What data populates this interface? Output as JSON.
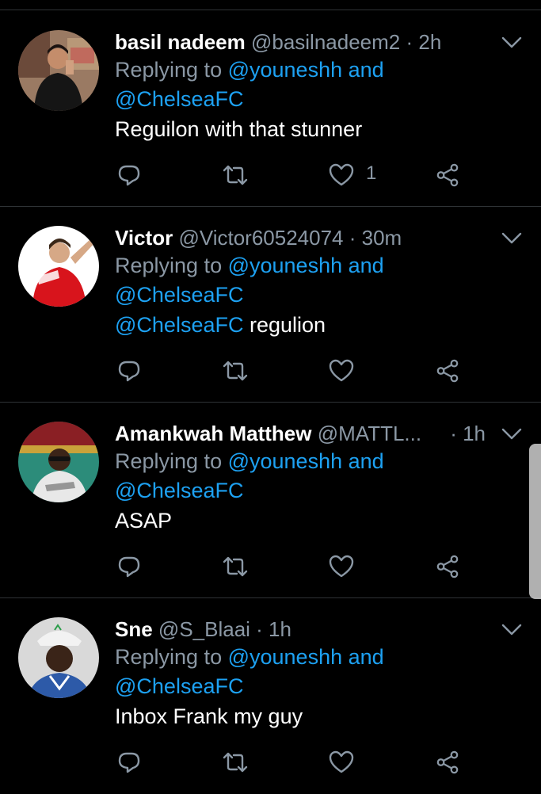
{
  "tweets": [
    {
      "name": "basil nadeem",
      "handle": "@basilnadeem2",
      "dot": " · ",
      "time": "2h",
      "reply_prefix": "Replying to ",
      "reply_user": "@youneshh",
      "reply_and": " and",
      "reply_user2": "@ChelseaFC",
      "body_mention": "",
      "body_text": "Reguilon with that stunner",
      "like_count": "1"
    },
    {
      "name": "Victor",
      "handle": "@Victor60524074",
      "dot": " · ",
      "time": "30m",
      "reply_prefix": "Replying to ",
      "reply_user": "@youneshh",
      "reply_and": " and",
      "reply_user2": "@ChelseaFC",
      "body_mention": "@ChelseaFC",
      "body_text": " regulion",
      "like_count": ""
    },
    {
      "name": "Amankwah Matthew",
      "handle": "@MATTL...",
      "dot": " · ",
      "time": "1h",
      "reply_prefix": "Replying to ",
      "reply_user": "@youneshh",
      "reply_and": " and",
      "reply_user2": "@ChelseaFC",
      "body_mention": "",
      "body_text": "ASAP",
      "like_count": ""
    },
    {
      "name": "Sne",
      "handle": "@S_Blaai",
      "dot": " · ",
      "time": "1h",
      "reply_prefix": "Replying to ",
      "reply_user": "@youneshh",
      "reply_and": " and",
      "reply_user2": "@ChelseaFC",
      "body_mention": "",
      "body_text": "Inbox Frank my guy",
      "like_count": ""
    }
  ],
  "icons": {
    "reply": "reply-icon",
    "retweet": "retweet-icon",
    "like": "heart-icon",
    "share": "share-icon",
    "more": "chevron-down-icon"
  },
  "colors": {
    "background": "#000000",
    "text": "#ffffff",
    "secondary": "#8b98a5",
    "link": "#1da1f2",
    "divider": "#2f3336"
  }
}
